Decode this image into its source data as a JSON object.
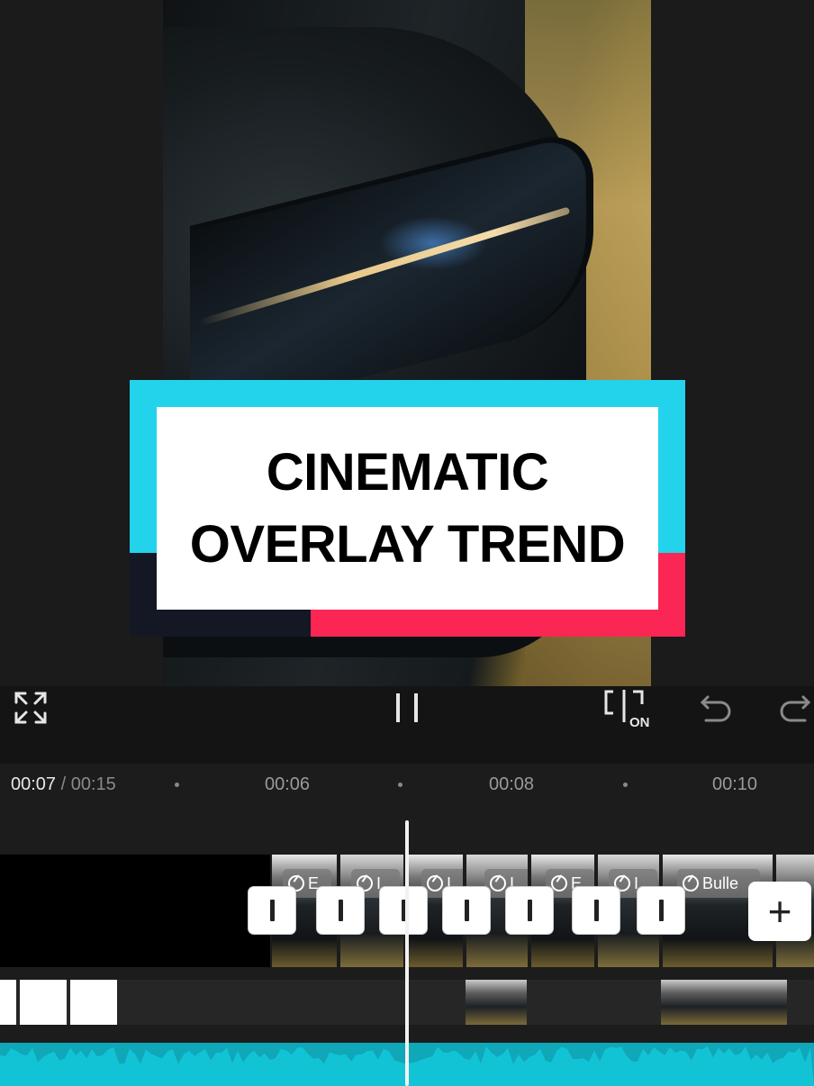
{
  "preview": {
    "title_card": {
      "line1": "CINEMATIC",
      "line2": "OVERLAY TREND",
      "colors": {
        "cyan": "#22d3eb",
        "red": "#fc2654",
        "navy": "#141825",
        "white": "#ffffff"
      }
    }
  },
  "controls": {
    "fullscreen_icon": "expand-arrows-icon",
    "play_pause_icon": "pause-icon",
    "autosnap_icon": "snap-on-icon",
    "autosnap_label": "ON",
    "undo_icon": "undo-icon",
    "redo_icon": "redo-icon"
  },
  "timeline": {
    "current_time": "00:07",
    "separator": " / ",
    "total_time": "00:15",
    "ticks": [
      "00:06",
      "00:08",
      "00:10"
    ],
    "clip_badges": [
      "E",
      "I",
      "I",
      "I",
      "E",
      "I",
      "Bulle"
    ],
    "add_clip_label": "+",
    "audio_color": "#10a7b8"
  }
}
